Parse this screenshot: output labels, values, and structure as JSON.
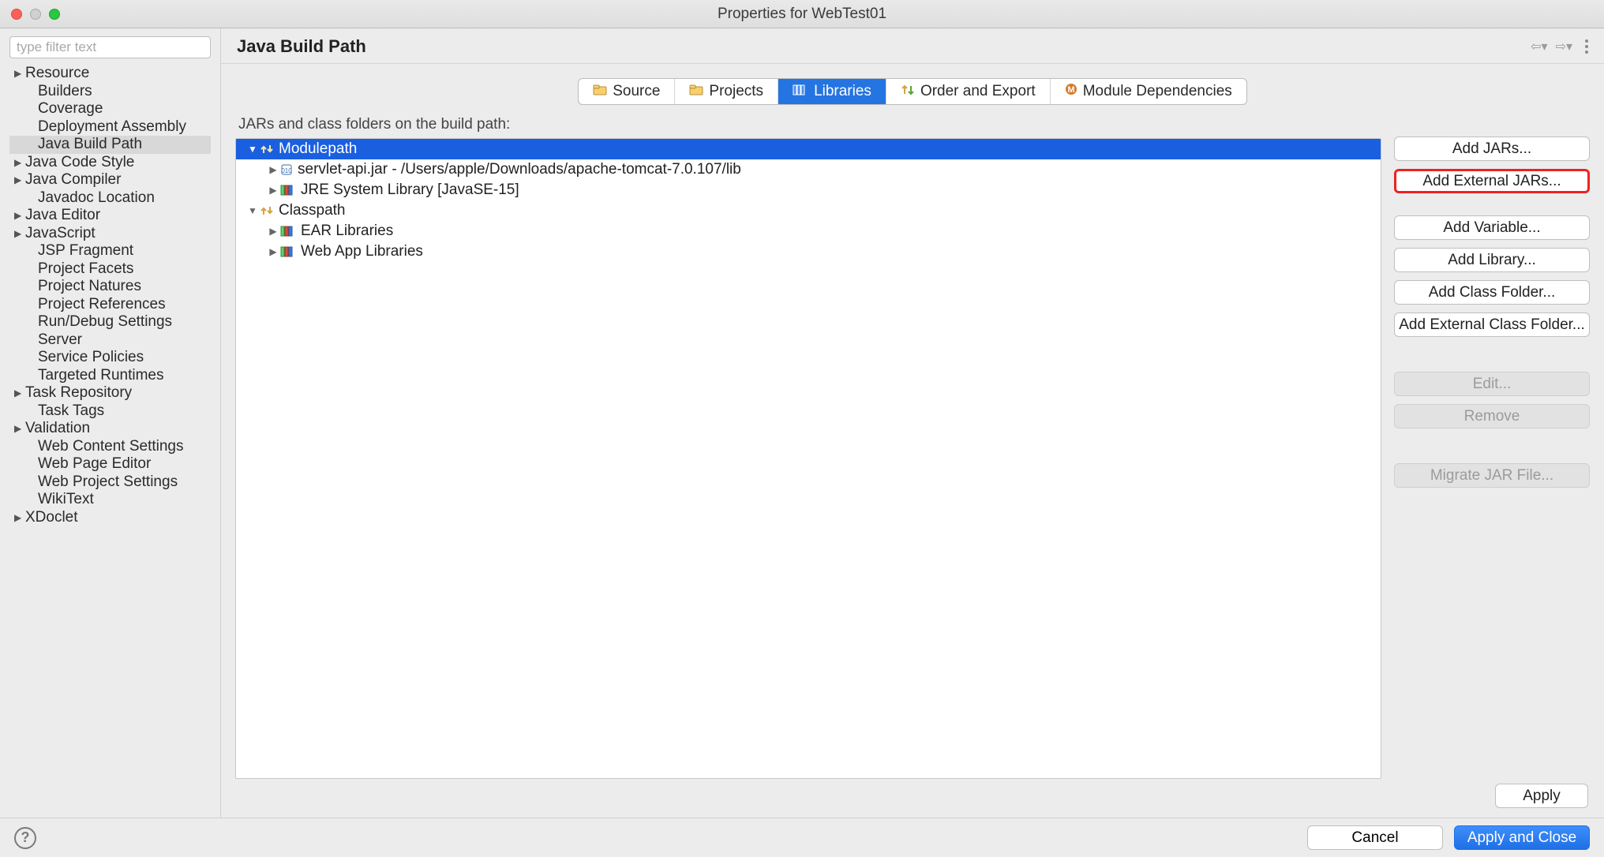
{
  "window": {
    "title": "Properties for WebTest01"
  },
  "sidebar": {
    "filter_placeholder": "type filter text",
    "items": [
      {
        "label": "Resource",
        "expand": true,
        "child": false,
        "selected": false
      },
      {
        "label": "Builders",
        "expand": false,
        "child": true,
        "selected": false
      },
      {
        "label": "Coverage",
        "expand": false,
        "child": true,
        "selected": false
      },
      {
        "label": "Deployment Assembly",
        "expand": false,
        "child": true,
        "selected": false
      },
      {
        "label": "Java Build Path",
        "expand": false,
        "child": true,
        "selected": true
      },
      {
        "label": "Java Code Style",
        "expand": true,
        "child": false,
        "selected": false
      },
      {
        "label": "Java Compiler",
        "expand": true,
        "child": false,
        "selected": false
      },
      {
        "label": "Javadoc Location",
        "expand": false,
        "child": true,
        "selected": false
      },
      {
        "label": "Java Editor",
        "expand": true,
        "child": false,
        "selected": false
      },
      {
        "label": "JavaScript",
        "expand": true,
        "child": false,
        "selected": false
      },
      {
        "label": "JSP Fragment",
        "expand": false,
        "child": true,
        "selected": false
      },
      {
        "label": "Project Facets",
        "expand": false,
        "child": true,
        "selected": false
      },
      {
        "label": "Project Natures",
        "expand": false,
        "child": true,
        "selected": false
      },
      {
        "label": "Project References",
        "expand": false,
        "child": true,
        "selected": false
      },
      {
        "label": "Run/Debug Settings",
        "expand": false,
        "child": true,
        "selected": false
      },
      {
        "label": "Server",
        "expand": false,
        "child": true,
        "selected": false
      },
      {
        "label": "Service Policies",
        "expand": false,
        "child": true,
        "selected": false
      },
      {
        "label": "Targeted Runtimes",
        "expand": false,
        "child": true,
        "selected": false
      },
      {
        "label": "Task Repository",
        "expand": true,
        "child": false,
        "selected": false
      },
      {
        "label": "Task Tags",
        "expand": false,
        "child": true,
        "selected": false
      },
      {
        "label": "Validation",
        "expand": true,
        "child": false,
        "selected": false
      },
      {
        "label": "Web Content Settings",
        "expand": false,
        "child": true,
        "selected": false
      },
      {
        "label": "Web Page Editor",
        "expand": false,
        "child": true,
        "selected": false
      },
      {
        "label": "Web Project Settings",
        "expand": false,
        "child": true,
        "selected": false
      },
      {
        "label": "WikiText",
        "expand": false,
        "child": true,
        "selected": false
      },
      {
        "label": "XDoclet",
        "expand": true,
        "child": false,
        "selected": false
      }
    ]
  },
  "header": {
    "title": "Java Build Path"
  },
  "tabs": [
    {
      "id": "source",
      "label": "Source"
    },
    {
      "id": "projects",
      "label": "Projects"
    },
    {
      "id": "libraries",
      "label": "Libraries",
      "active": true
    },
    {
      "id": "order",
      "label": "Order and Export"
    },
    {
      "id": "module",
      "label": "Module Dependencies"
    }
  ],
  "list_label": "JARs and class folders on the build path:",
  "rows": [
    {
      "label": "Modulepath",
      "depth": 0,
      "kind": "pkg",
      "disc": "down",
      "selected": true
    },
    {
      "label": "servlet-api.jar - /Users/apple/Downloads/apache-tomcat-7.0.107/lib",
      "depth": 1,
      "kind": "jar",
      "disc": "right"
    },
    {
      "label": "JRE System Library [JavaSE-15]",
      "depth": 1,
      "kind": "lib",
      "disc": "right"
    },
    {
      "label": "Classpath",
      "depth": 0,
      "kind": "pkg",
      "disc": "down"
    },
    {
      "label": "EAR Libraries",
      "depth": 1,
      "kind": "lib",
      "disc": "right"
    },
    {
      "label": "Web App Libraries",
      "depth": 1,
      "kind": "lib",
      "disc": "right"
    }
  ],
  "buttons": {
    "add_jars": "Add JARs...",
    "add_ext_jars": "Add External JARs...",
    "add_variable": "Add Variable...",
    "add_library": "Add Library...",
    "add_class_folder": "Add Class Folder...",
    "add_ext_class_folder": "Add External Class Folder...",
    "edit": "Edit...",
    "remove": "Remove",
    "migrate": "Migrate JAR File...",
    "apply": "Apply"
  },
  "footer": {
    "cancel": "Cancel",
    "apply_close": "Apply and Close"
  }
}
